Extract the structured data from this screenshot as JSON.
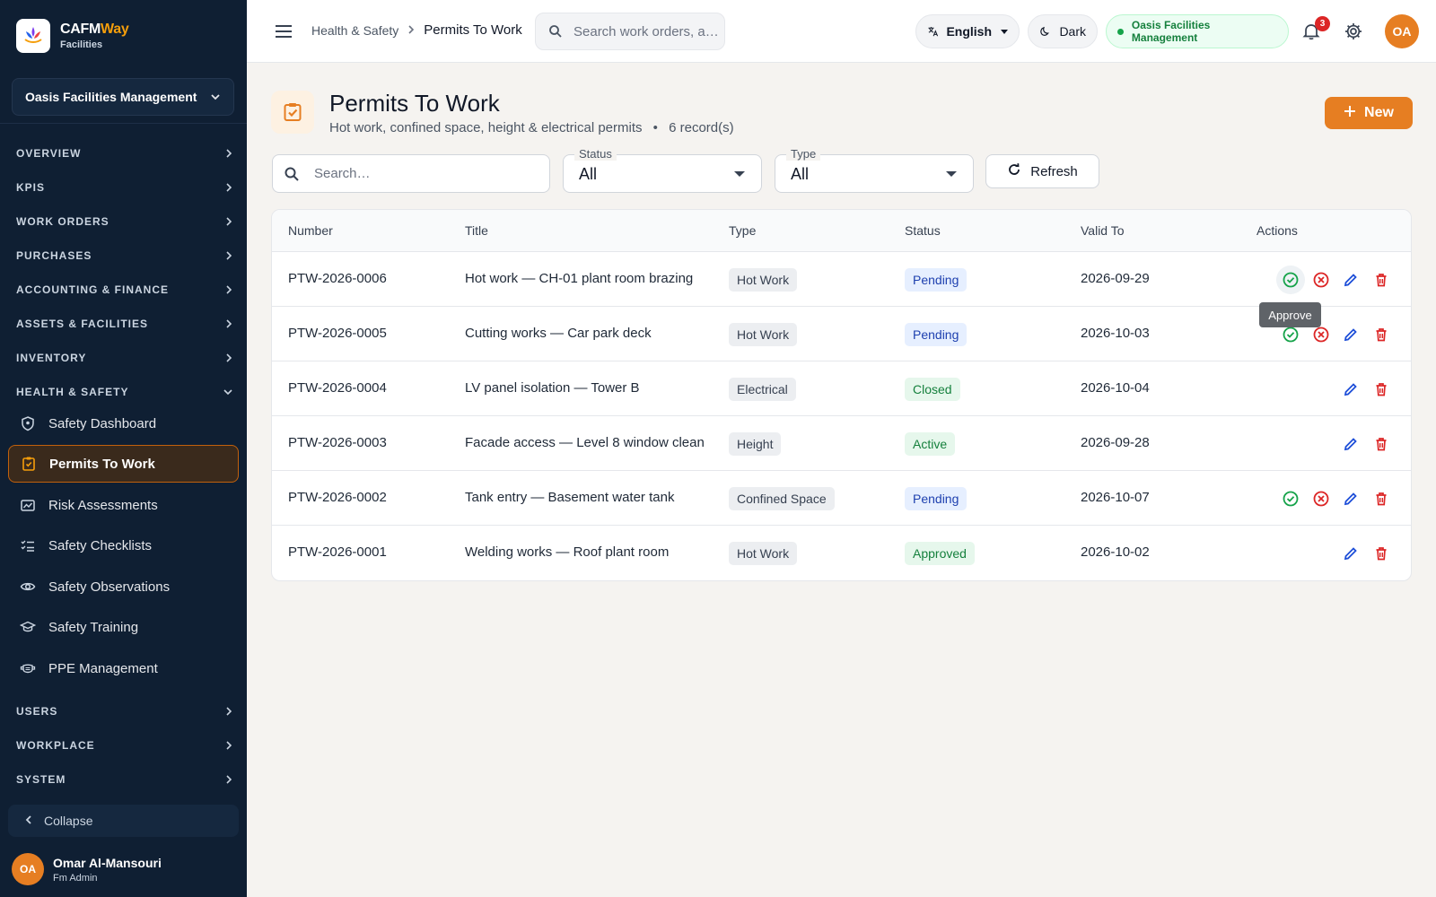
{
  "brand": {
    "name_a": "CAFM",
    "name_b": "Way",
    "sub": "Facilities"
  },
  "org_selector": {
    "label": "Oasis Facilities Management"
  },
  "nav": {
    "sections_top": [
      {
        "label": "OVERVIEW"
      },
      {
        "label": "KPIS"
      },
      {
        "label": "WORK ORDERS"
      },
      {
        "label": "PURCHASES"
      },
      {
        "label": "ACCOUNTING & FINANCE"
      },
      {
        "label": "ASSETS & FACILITIES"
      },
      {
        "label": "INVENTORY"
      },
      {
        "label": "HEALTH & SAFETY"
      }
    ],
    "hs_items": [
      {
        "label": "Safety Dashboard",
        "icon": "shield-icon"
      },
      {
        "label": "Permits To Work",
        "icon": "clipboard-check-icon"
      },
      {
        "label": "Risk Assessments",
        "icon": "risk-icon"
      },
      {
        "label": "Safety Checklists",
        "icon": "checklist-icon"
      },
      {
        "label": "Safety Observations",
        "icon": "eye-icon"
      },
      {
        "label": "Safety Training",
        "icon": "graduation-cap-icon"
      },
      {
        "label": "PPE Management",
        "icon": "mask-icon"
      }
    ],
    "sections_bottom": [
      {
        "label": "USERS"
      },
      {
        "label": "WORKPLACE"
      },
      {
        "label": "SYSTEM"
      }
    ],
    "collapse_label": "Collapse"
  },
  "user": {
    "initials": "OA",
    "name": "Omar Al-Mansouri",
    "role": "Fm Admin"
  },
  "topbar": {
    "breadcrumb_parent": "Health & Safety",
    "breadcrumb_current": "Permits To Work",
    "search_placeholder": "Search work orders, a…",
    "language": "English",
    "theme": "Dark",
    "org": "Oasis Facilities Management",
    "notification_count": "3",
    "avatar_initials": "OA"
  },
  "page": {
    "title": "Permits To Work",
    "subtitle": "Hot work, confined space, height & electrical permits",
    "record_count": "6 record(s)",
    "new_label": "New"
  },
  "filters": {
    "search_placeholder": "Search…",
    "status_legend": "Status",
    "status_value": "All",
    "type_legend": "Type",
    "type_value": "All",
    "refresh_label": "Refresh"
  },
  "table": {
    "headers": [
      "Number",
      "Title",
      "Type",
      "Status",
      "Valid To",
      "Actions"
    ],
    "rows": [
      {
        "number": "PTW-2026-0006",
        "title": "Hot work — CH-01 plant room brazing",
        "type": "Hot Work",
        "status": "Pending",
        "valid_to": "2026-09-29",
        "can_approve": true
      },
      {
        "number": "PTW-2026-0005",
        "title": "Cutting works — Car park deck",
        "type": "Hot Work",
        "status": "Pending",
        "valid_to": "2026-10-03",
        "can_approve": true
      },
      {
        "number": "PTW-2026-0004",
        "title": "LV panel isolation — Tower B",
        "type": "Electrical",
        "status": "Closed",
        "valid_to": "2026-10-04",
        "can_approve": false
      },
      {
        "number": "PTW-2026-0003",
        "title": "Facade access — Level 8 window clean",
        "type": "Height",
        "status": "Active",
        "valid_to": "2026-09-28",
        "can_approve": false
      },
      {
        "number": "PTW-2026-0002",
        "title": "Tank entry — Basement water tank",
        "type": "Confined Space",
        "status": "Pending",
        "valid_to": "2026-10-07",
        "can_approve": true
      },
      {
        "number": "PTW-2026-0001",
        "title": "Welding works — Roof plant room",
        "type": "Hot Work",
        "status": "Approved",
        "valid_to": "2026-10-02",
        "can_approve": false
      }
    ]
  },
  "tooltip": {
    "text": "Approve"
  },
  "colors": {
    "sidebar_bg": "#0f1f33",
    "accent": "#e67e22",
    "pending": "#1e40af",
    "success": "#15803d",
    "danger": "#dc2626",
    "edit": "#1d4ed8"
  }
}
